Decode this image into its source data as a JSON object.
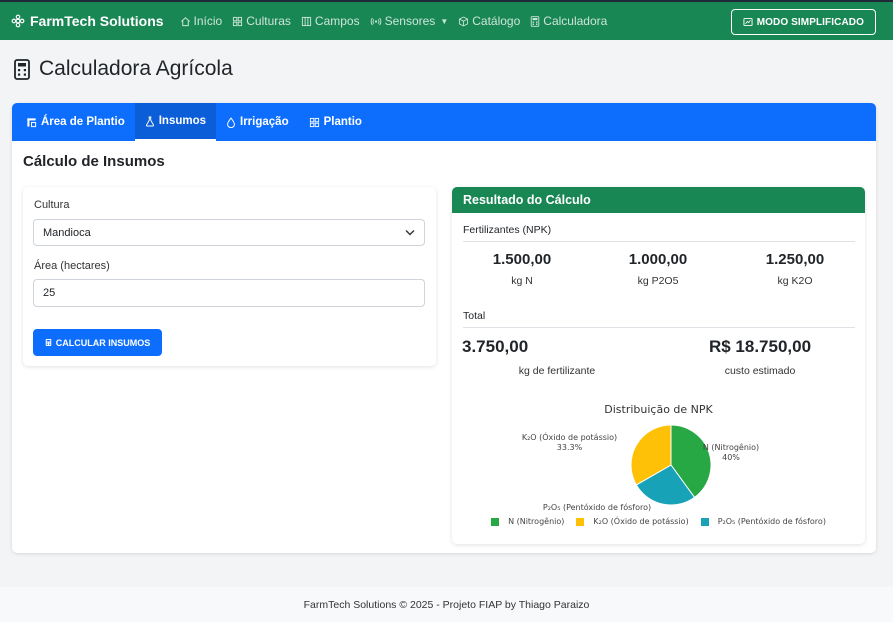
{
  "navbar": {
    "brand": "FarmTech Solutions",
    "items": [
      {
        "label": "Início",
        "icon": "house-icon"
      },
      {
        "label": "Culturas",
        "icon": "grid-icon"
      },
      {
        "label": "Campos",
        "icon": "columns-icon"
      },
      {
        "label": "Sensores",
        "icon": "broadcast-icon"
      },
      {
        "label": "Catálogo",
        "icon": "box-icon"
      },
      {
        "label": "Calculadora",
        "icon": "calculator-icon"
      }
    ],
    "mode_button": "MODO SIMPLIFICADO"
  },
  "page": {
    "title": "Calculadora Agrícola"
  },
  "tabs": [
    {
      "label": "Área de Plantio",
      "icon": "bounding-box-icon"
    },
    {
      "label": "Insumos",
      "icon": "flask-icon"
    },
    {
      "label": "Irrigação",
      "icon": "droplet-icon"
    },
    {
      "label": "Plantio",
      "icon": "grid-icon"
    }
  ],
  "active_tab": "Insumos",
  "section_title": "Cálculo de Insumos",
  "form": {
    "culture_label": "Cultura",
    "culture_value": "Mandioca",
    "area_label": "Área (hectares)",
    "area_value": "25",
    "submit_label": "CALCULAR INSUMOS"
  },
  "result": {
    "header": "Resultado do Cálculo",
    "fertilizers_label": "Fertilizantes (NPK)",
    "n_value": "1.500,00",
    "n_unit": "kg N",
    "p_value": "1.000,00",
    "p_unit": "kg P2O5",
    "k_value": "1.250,00",
    "k_unit": "kg K2O",
    "total_label": "Total",
    "total_value": "3.750,00",
    "total_unit": "kg de fertilizante",
    "cost_value": "R$ 18.750,00",
    "cost_unit": "custo estimado"
  },
  "chart_data": {
    "type": "pie",
    "title": "Distribuição de NPK",
    "labels": [
      "N (Nitrogênio)",
      "K₂O (Óxido de potássio)",
      "P₂O₅ (Pentóxido de fósforo)"
    ],
    "values": [
      40,
      33.3,
      26.7
    ],
    "percent_labels": [
      "40%",
      "33.3%",
      ""
    ],
    "colors": [
      "#28a745",
      "#ffc107",
      "#17a2b8"
    ],
    "legend_position": "bottom"
  },
  "footer": {
    "text": "FarmTech Solutions © 2025 - Projeto FIAP by Thiago Paraizo"
  }
}
